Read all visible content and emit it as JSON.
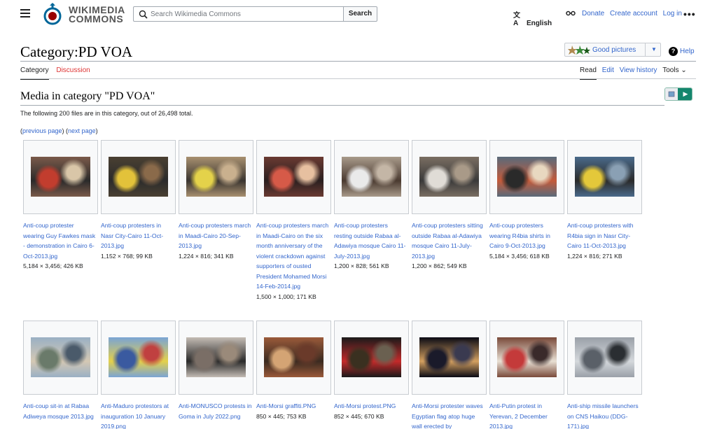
{
  "header": {
    "logo_line1": "WIKIMEDIA",
    "logo_line2": "COMMONS",
    "search_placeholder": "Search Wikimedia Commons",
    "search_button": "Search",
    "language": "English",
    "links": [
      "Donate",
      "Create account",
      "Log in"
    ],
    "more": "•••"
  },
  "page": {
    "title": "Category:PD VOA",
    "good_pictures": "Good pictures",
    "help": "Help",
    "tabs_left": [
      "Category",
      "Discussion"
    ],
    "tabs_right": [
      "Read",
      "Edit",
      "View history"
    ],
    "tools": "Tools"
  },
  "content": {
    "section_title": "Media in category \"PD VOA\"",
    "count_text": "The following 200 files are in this category, out of 26,498 total.",
    "pager_prev": "previous page",
    "pager_next": "next page"
  },
  "colors": {
    "link": "#3366cc",
    "red_link": "#d33333",
    "slideshow_green": "#14866d"
  },
  "gallery": [
    {
      "caption": "Anti-coup protester wearing Guy Fawkes mask - demonstration in Cairo 6-Oct-2013.jpg",
      "meta": "5,184 × 3,456; 426 KB",
      "palette": [
        "#7a5a4a",
        "#c23d2e",
        "#2a2a2a",
        "#d9c6a8"
      ]
    },
    {
      "caption": "Anti-coup protesters in Nasr City-Cairo 11-Oct-2013.jpg",
      "meta": "1,152 × 768; 99 KB",
      "palette": [
        "#4a4032",
        "#e3c23a",
        "#2b2b2b",
        "#8a6a4a"
      ]
    },
    {
      "caption": "Anti-coup protesters march in Maadi-Cairo 20-Sep-2013.jpg",
      "meta": "1,224 × 816; 341 KB",
      "palette": [
        "#a89070",
        "#e4d24a",
        "#3a3530",
        "#c9b08e"
      ]
    },
    {
      "caption": "Anti-coup protesters march in Maadi-Cairo on the six month anniversary of the violent crackdown against supporters of ousted President Mohamed Morsi 14-Feb-2014.jpg",
      "meta": "1,500 × 1,000; 171 KB",
      "palette": [
        "#6a3a32",
        "#d65a48",
        "#2a1f1f",
        "#e7c0a0"
      ]
    },
    {
      "caption": "Anti-coup protesters resting outside Rabaa al-Adawiya mosque Cairo 11-July-2013.jpg",
      "meta": "1,200 × 828; 561 KB",
      "palette": [
        "#a89a8a",
        "#eaeaea",
        "#4a3a30",
        "#c4b6a6"
      ]
    },
    {
      "caption": "Anti-coup protesters sitting outside Rabaa al-Adawiya mosque Cairo 11-July-2013.jpg",
      "meta": "1,200 × 862; 549 KB",
      "palette": [
        "#7a6e62",
        "#e0dcd6",
        "#3a3a3a",
        "#a99a88"
      ]
    },
    {
      "caption": "Anti-coup protesters wearing R4bia shirts in Cairo 9-Oct-2013.jpg",
      "meta": "5,184 × 3,456; 618 KB",
      "palette": [
        "#5a6a7a",
        "#2a2a2a",
        "#c45a3a",
        "#e8d8c0"
      ]
    },
    {
      "caption": "Anti-coup protesters with R4bia sign in Nasr City-Cairo 11-Oct-2013.jpg",
      "meta": "1,224 × 816; 271 KB",
      "palette": [
        "#4a6a8a",
        "#e4c83a",
        "#2a2a2a",
        "#8aa0b4"
      ]
    },
    {
      "caption": "Anti-coup sit-in at Rabaa Adiweya mosque 2013.jpg",
      "meta": "",
      "palette": [
        "#9ab0c4",
        "#6a7a6a",
        "#d4c8b4",
        "#4a5a6a"
      ]
    },
    {
      "caption": "Anti-Maduro protestors at inauguration 10 January 2019.png",
      "meta": "",
      "palette": [
        "#7aa4d4",
        "#3a5aa0",
        "#e4d04a",
        "#c04040"
      ]
    },
    {
      "caption": "Anti-MONUSCO protests in Goma in July 2022.png",
      "meta": "",
      "palette": [
        "#c4bcb4",
        "#7a6e66",
        "#2a2a2a",
        "#9a8a7a"
      ]
    },
    {
      "caption": "Anti-Morsi graffiti.PNG",
      "meta": "850 × 445; 753 KB",
      "palette": [
        "#9a5a3a",
        "#d4a474",
        "#3a2a20",
        "#6a3a2a"
      ]
    },
    {
      "caption": "Anti-Morsi protest.PNG",
      "meta": "852 × 445; 670 KB",
      "palette": [
        "#1a1a1a",
        "#3a3020",
        "#c42a2a",
        "#6a6050"
      ]
    },
    {
      "caption": "Anti-Morsi protester waves Egyptian flag atop huge wall erected by",
      "meta": "",
      "palette": [
        "#0a0a14",
        "#1a1a2a",
        "#d4a060",
        "#3a3a50"
      ]
    },
    {
      "caption": "Anti-Putin protest in Yerevan, 2 December 2013.jpg",
      "meta": "",
      "palette": [
        "#7a4a3a",
        "#c43a3a",
        "#e8e0d4",
        "#3a2a2a"
      ]
    },
    {
      "caption": "Anti-ship missile launchers on CNS Haikou (DDG-171).jpg",
      "meta": "",
      "palette": [
        "#9aa0a8",
        "#5a6068",
        "#d4d8dc",
        "#2a2e32"
      ]
    }
  ]
}
